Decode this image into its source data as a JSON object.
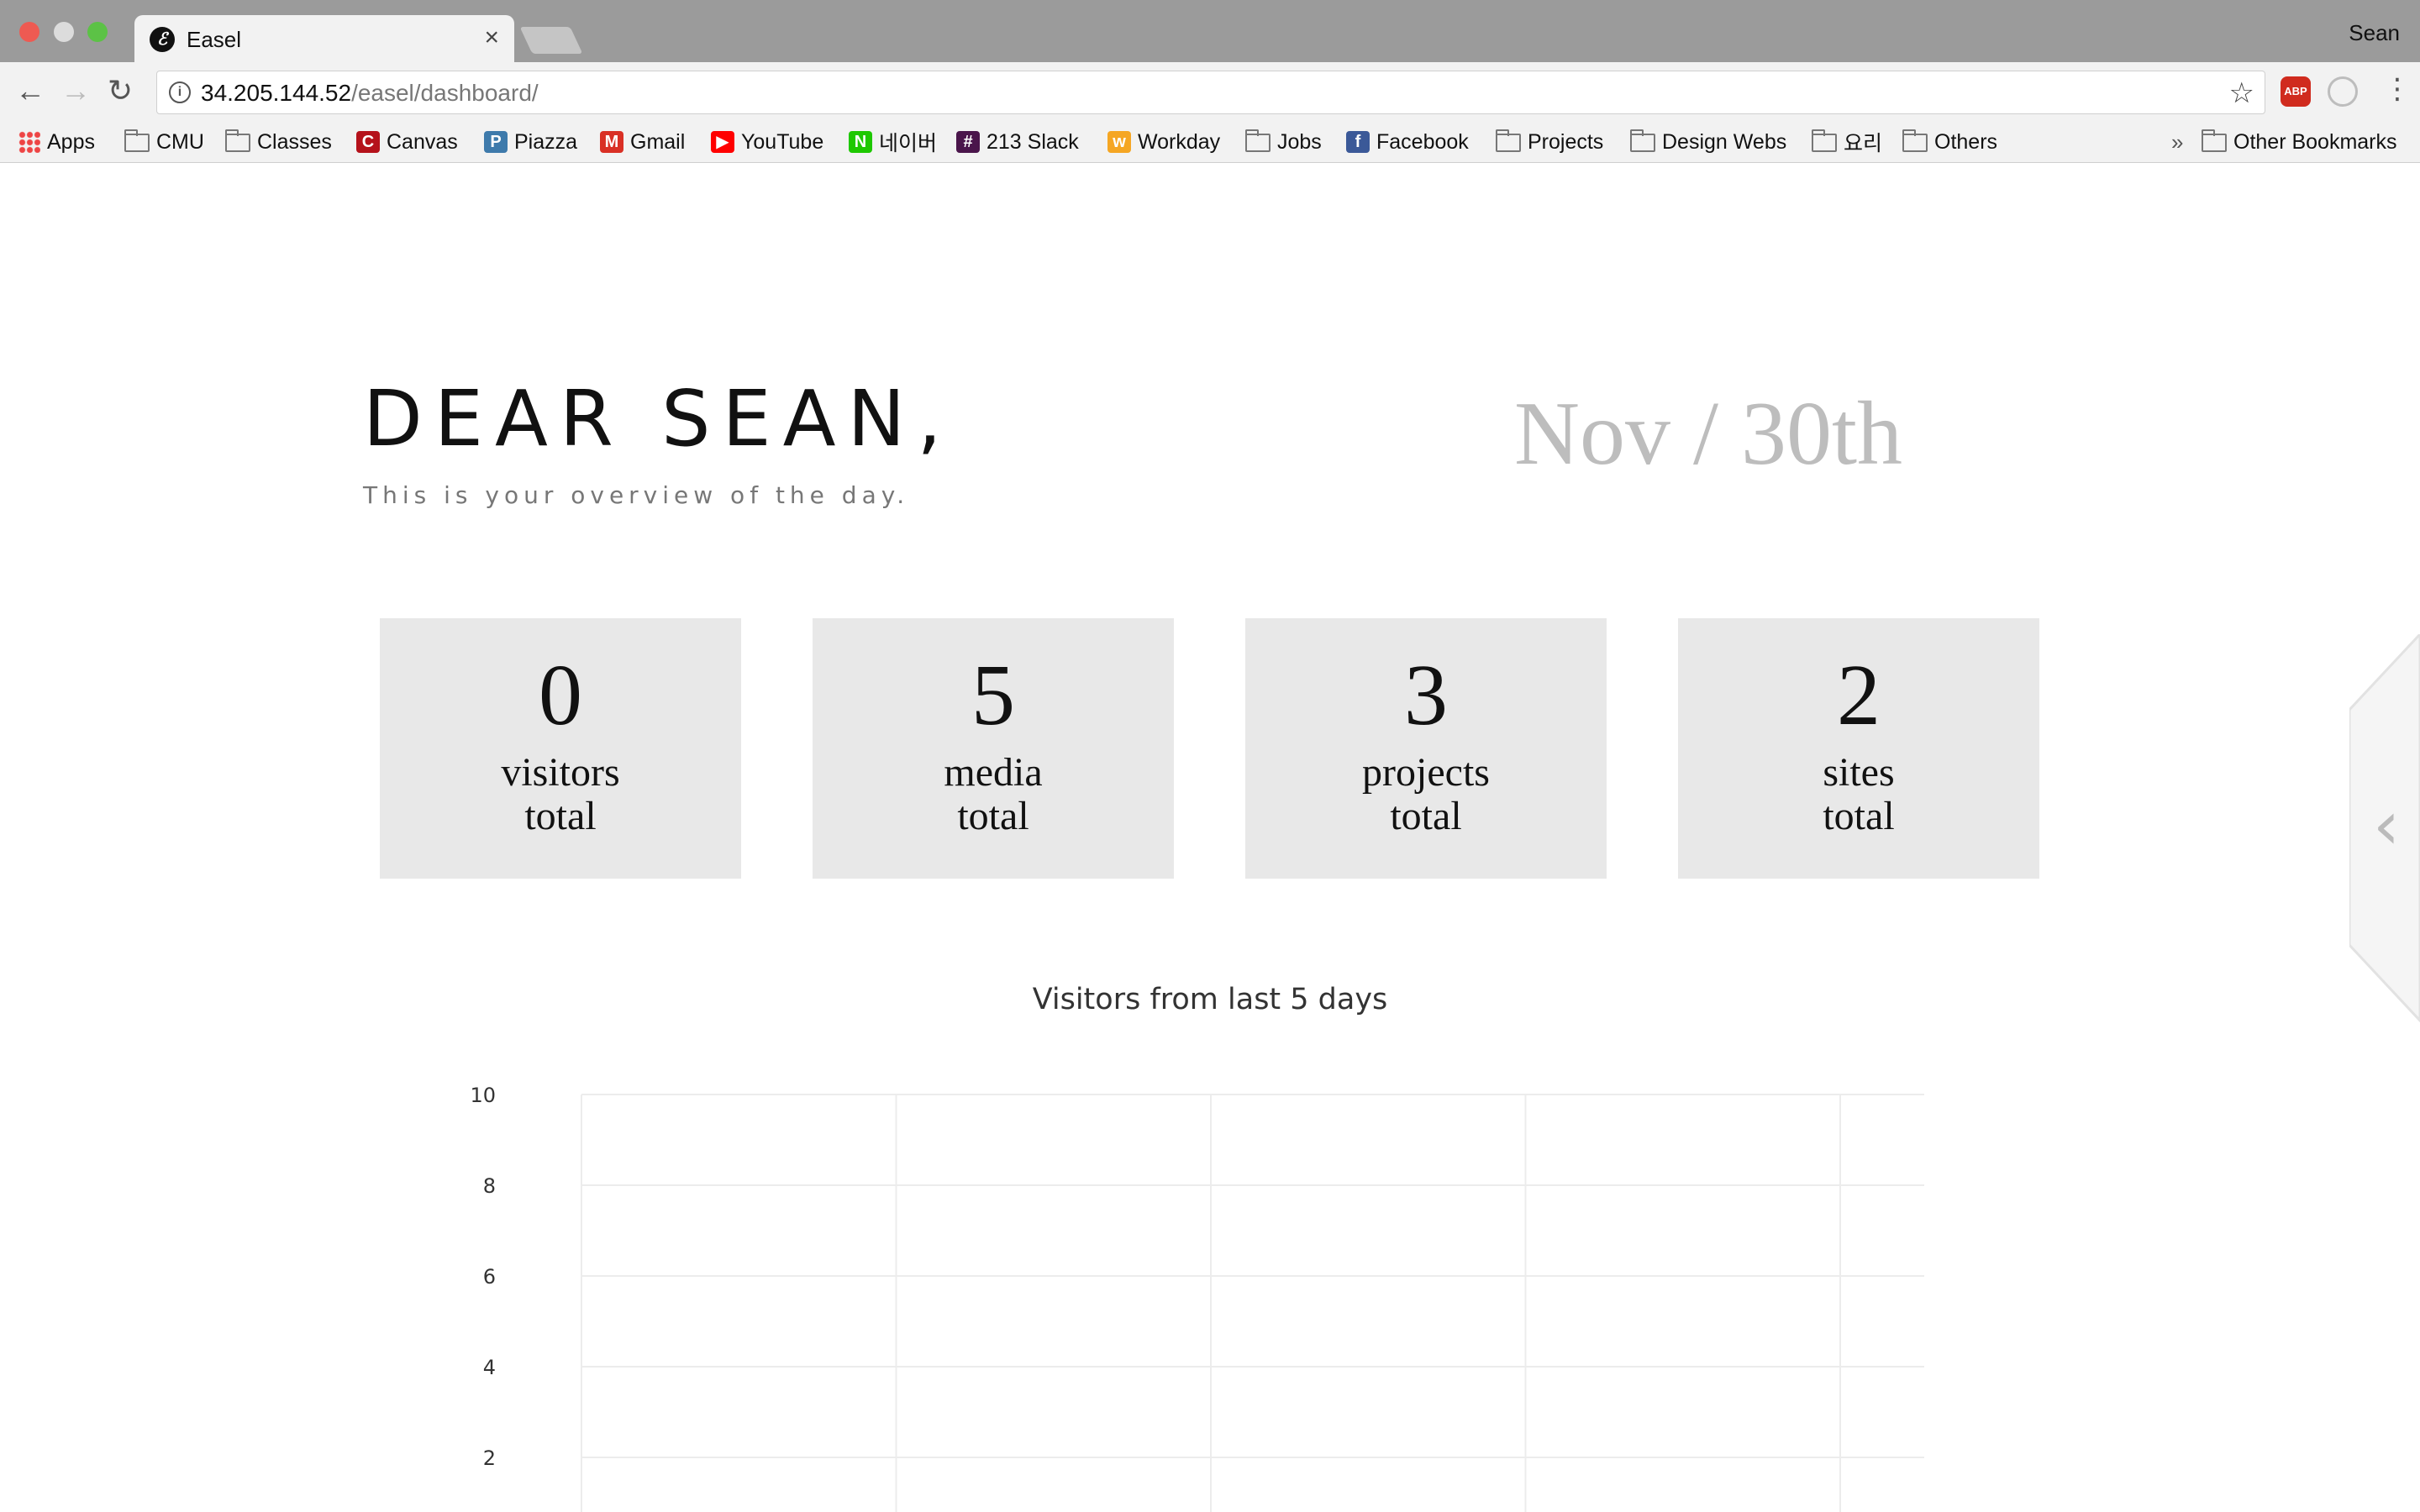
{
  "browser": {
    "tab_title": "Easel",
    "tab_close": "×",
    "profile_name": "Sean",
    "url_host": "34.205.144.52",
    "url_path": "/easel/dashboard/",
    "info_glyph": "i",
    "star_glyph": "☆",
    "menu_glyph": "⋮",
    "abp_label": "ABP",
    "back_glyph": "←",
    "forward_glyph": "→",
    "reload_glyph": "↻",
    "chevron_glyph": "»"
  },
  "bookmarks": {
    "items": [
      {
        "label": "Apps",
        "icon": "apps-grid-icon"
      },
      {
        "label": "CMU",
        "icon": "folder-icon"
      },
      {
        "label": "Classes",
        "icon": "folder-icon"
      },
      {
        "label": "Canvas",
        "icon": "canvas-icon",
        "glyph": "C",
        "color": "#b5121b"
      },
      {
        "label": "Piazza",
        "icon": "piazza-icon",
        "glyph": "P",
        "color": "#3e7aab"
      },
      {
        "label": "Gmail",
        "icon": "gmail-icon",
        "glyph": "M",
        "color": "#d93025"
      },
      {
        "label": "YouTube",
        "icon": "youtube-icon",
        "glyph": "▶",
        "color": "#ff0000"
      },
      {
        "label": "네이버",
        "icon": "naver-icon",
        "glyph": "N",
        "color": "#1ec800"
      },
      {
        "label": "213 Slack",
        "icon": "slack-icon",
        "glyph": "#",
        "color": "#4a154b"
      },
      {
        "label": "Workday",
        "icon": "workday-icon",
        "glyph": "w",
        "color": "#f5a623"
      },
      {
        "label": "Jobs",
        "icon": "folder-icon"
      },
      {
        "label": "Facebook",
        "icon": "facebook-icon",
        "glyph": "f",
        "color": "#3b5998"
      },
      {
        "label": "Projects",
        "icon": "folder-icon"
      },
      {
        "label": "Design Webs",
        "icon": "folder-icon"
      },
      {
        "label": "요리",
        "icon": "folder-icon"
      },
      {
        "label": "Others",
        "icon": "folder-icon"
      }
    ],
    "other_bookmarks": "Other Bookmarks"
  },
  "page": {
    "greeting": "DEAR SEAN,",
    "subtitle": "This is your overview of the day.",
    "date": "Nov / 30th",
    "stats": [
      {
        "value": "0",
        "label_line1": "visitors",
        "label_line2": "total"
      },
      {
        "value": "5",
        "label_line1": "media",
        "label_line2": "total"
      },
      {
        "value": "3",
        "label_line1": "projects",
        "label_line2": "total"
      },
      {
        "value": "2",
        "label_line1": "sites",
        "label_line2": "total"
      }
    ],
    "side_panel_glyph": "‹"
  },
  "chart_data": {
    "type": "line",
    "title": "Visitors from last 5 days",
    "xlabel": "",
    "ylabel": "",
    "ylim": [
      0,
      10
    ],
    "yticks": [
      10,
      8,
      6,
      4,
      2
    ],
    "categories": [
      "",
      "",
      "",
      "",
      ""
    ],
    "series": [],
    "grid": true
  }
}
